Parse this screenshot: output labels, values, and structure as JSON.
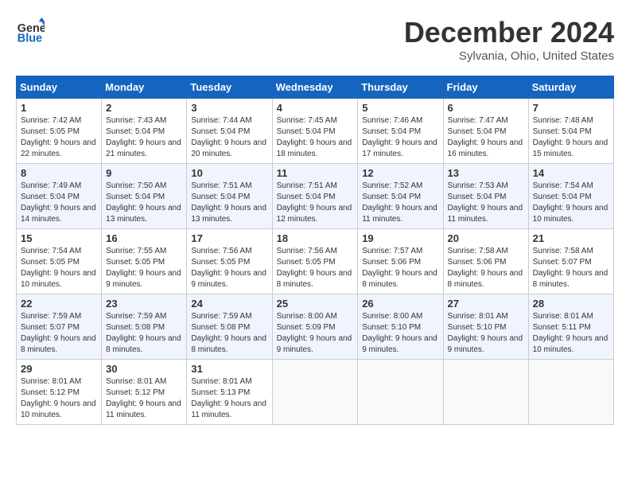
{
  "header": {
    "logo_general": "General",
    "logo_blue": "Blue",
    "month": "December 2024",
    "location": "Sylvania, Ohio, United States"
  },
  "weekdays": [
    "Sunday",
    "Monday",
    "Tuesday",
    "Wednesday",
    "Thursday",
    "Friday",
    "Saturday"
  ],
  "weeks": [
    [
      {
        "day": "1",
        "sunrise": "7:42 AM",
        "sunset": "5:05 PM",
        "daylight": "9 hours and 22 minutes."
      },
      {
        "day": "2",
        "sunrise": "7:43 AM",
        "sunset": "5:04 PM",
        "daylight": "9 hours and 21 minutes."
      },
      {
        "day": "3",
        "sunrise": "7:44 AM",
        "sunset": "5:04 PM",
        "daylight": "9 hours and 20 minutes."
      },
      {
        "day": "4",
        "sunrise": "7:45 AM",
        "sunset": "5:04 PM",
        "daylight": "9 hours and 18 minutes."
      },
      {
        "day": "5",
        "sunrise": "7:46 AM",
        "sunset": "5:04 PM",
        "daylight": "9 hours and 17 minutes."
      },
      {
        "day": "6",
        "sunrise": "7:47 AM",
        "sunset": "5:04 PM",
        "daylight": "9 hours and 16 minutes."
      },
      {
        "day": "7",
        "sunrise": "7:48 AM",
        "sunset": "5:04 PM",
        "daylight": "9 hours and 15 minutes."
      }
    ],
    [
      {
        "day": "8",
        "sunrise": "7:49 AM",
        "sunset": "5:04 PM",
        "daylight": "9 hours and 14 minutes."
      },
      {
        "day": "9",
        "sunrise": "7:50 AM",
        "sunset": "5:04 PM",
        "daylight": "9 hours and 13 minutes."
      },
      {
        "day": "10",
        "sunrise": "7:51 AM",
        "sunset": "5:04 PM",
        "daylight": "9 hours and 13 minutes."
      },
      {
        "day": "11",
        "sunrise": "7:51 AM",
        "sunset": "5:04 PM",
        "daylight": "9 hours and 12 minutes."
      },
      {
        "day": "12",
        "sunrise": "7:52 AM",
        "sunset": "5:04 PM",
        "daylight": "9 hours and 11 minutes."
      },
      {
        "day": "13",
        "sunrise": "7:53 AM",
        "sunset": "5:04 PM",
        "daylight": "9 hours and 11 minutes."
      },
      {
        "day": "14",
        "sunrise": "7:54 AM",
        "sunset": "5:04 PM",
        "daylight": "9 hours and 10 minutes."
      }
    ],
    [
      {
        "day": "15",
        "sunrise": "7:54 AM",
        "sunset": "5:05 PM",
        "daylight": "9 hours and 10 minutes."
      },
      {
        "day": "16",
        "sunrise": "7:55 AM",
        "sunset": "5:05 PM",
        "daylight": "9 hours and 9 minutes."
      },
      {
        "day": "17",
        "sunrise": "7:56 AM",
        "sunset": "5:05 PM",
        "daylight": "9 hours and 9 minutes."
      },
      {
        "day": "18",
        "sunrise": "7:56 AM",
        "sunset": "5:05 PM",
        "daylight": "9 hours and 8 minutes."
      },
      {
        "day": "19",
        "sunrise": "7:57 AM",
        "sunset": "5:06 PM",
        "daylight": "9 hours and 8 minutes."
      },
      {
        "day": "20",
        "sunrise": "7:58 AM",
        "sunset": "5:06 PM",
        "daylight": "9 hours and 8 minutes."
      },
      {
        "day": "21",
        "sunrise": "7:58 AM",
        "sunset": "5:07 PM",
        "daylight": "9 hours and 8 minutes."
      }
    ],
    [
      {
        "day": "22",
        "sunrise": "7:59 AM",
        "sunset": "5:07 PM",
        "daylight": "9 hours and 8 minutes."
      },
      {
        "day": "23",
        "sunrise": "7:59 AM",
        "sunset": "5:08 PM",
        "daylight": "9 hours and 8 minutes."
      },
      {
        "day": "24",
        "sunrise": "7:59 AM",
        "sunset": "5:08 PM",
        "daylight": "9 hours and 8 minutes."
      },
      {
        "day": "25",
        "sunrise": "8:00 AM",
        "sunset": "5:09 PM",
        "daylight": "9 hours and 9 minutes."
      },
      {
        "day": "26",
        "sunrise": "8:00 AM",
        "sunset": "5:10 PM",
        "daylight": "9 hours and 9 minutes."
      },
      {
        "day": "27",
        "sunrise": "8:01 AM",
        "sunset": "5:10 PM",
        "daylight": "9 hours and 9 minutes."
      },
      {
        "day": "28",
        "sunrise": "8:01 AM",
        "sunset": "5:11 PM",
        "daylight": "9 hours and 10 minutes."
      }
    ],
    [
      {
        "day": "29",
        "sunrise": "8:01 AM",
        "sunset": "5:12 PM",
        "daylight": "9 hours and 10 minutes."
      },
      {
        "day": "30",
        "sunrise": "8:01 AM",
        "sunset": "5:12 PM",
        "daylight": "9 hours and 11 minutes."
      },
      {
        "day": "31",
        "sunrise": "8:01 AM",
        "sunset": "5:13 PM",
        "daylight": "9 hours and 11 minutes."
      },
      null,
      null,
      null,
      null
    ]
  ],
  "labels": {
    "sunrise": "Sunrise:",
    "sunset": "Sunset:",
    "daylight": "Daylight:"
  }
}
